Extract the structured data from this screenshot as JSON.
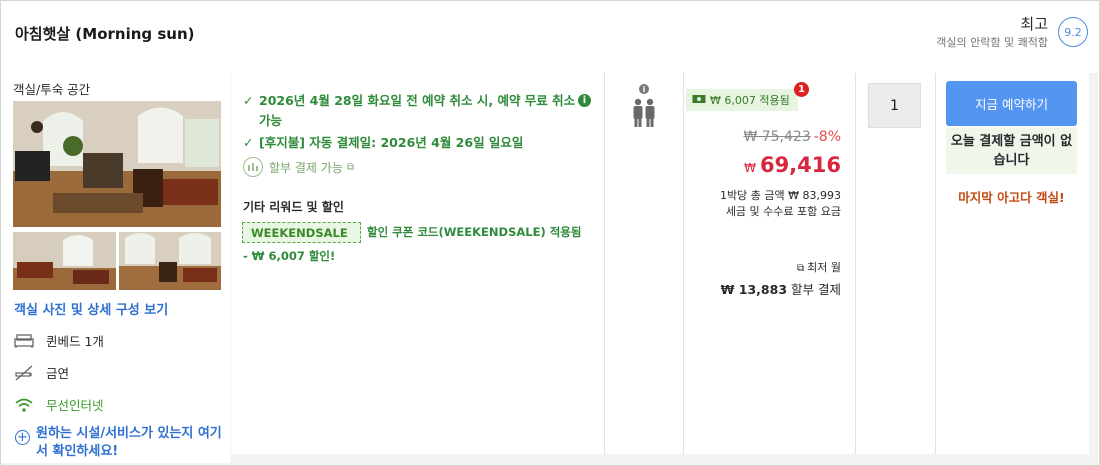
{
  "header": {
    "room_title": "아침햇살 (Morning sun)",
    "rating_word": "최고",
    "rating_sub": "객실의 안락함 및 쾌적함",
    "rating_score": "9.2"
  },
  "left": {
    "space_label": "객실/투숙 공간",
    "photos_link": "객실 사진 및 상세 구성 보기",
    "features": [
      {
        "icon": "bed-icon",
        "label": "퀸베드 1개"
      },
      {
        "icon": "no-smoking-icon",
        "label": "금연"
      },
      {
        "icon": "wifi-icon",
        "label": "무선인터넷"
      }
    ],
    "more_amenities": "원하는 시설/서비스가 있는지 여기서 확인하세요!"
  },
  "info": {
    "cancel_policy": "2026년 4월 28일 화요일 전 예약 취소 시, 예약 무료 취소 가능",
    "pay_later": "[후지불] 자동 결제일: 2026년 4월 26일 일요일",
    "installment": "할부 결제 가능",
    "promo_title": "기타 리워드 및 할인",
    "coupon_code": "WEEKENDSALE",
    "coupon_text": "할인 쿠폰 코드(WEEKENDSALE) 적용됨",
    "coupon_discount": "- ₩ 6,007 할인!"
  },
  "price": {
    "save_tag": "₩ 6,007 적용됨",
    "notification_count": "1",
    "original": "₩ 75,423",
    "discount_pct": "-8%",
    "currency": "₩",
    "final": "69,416",
    "per_night": "1박당 총 금액 ₩ 83,993",
    "taxes": "세금 및 수수료 포함 요금",
    "monthly_label": "최저 월",
    "monthly_amount": "₩ 13,883",
    "monthly_suffix": "할부 결제"
  },
  "quantity": "1",
  "cta": {
    "book_now": "지금 예약하기",
    "pay_today": "오늘 결제할 금액이 없습니다",
    "last_chance": "마지막 아고다 객실!"
  },
  "colors": {
    "accent_blue": "#5495f2",
    "green": "#2e8b3a",
    "price_red": "#d7263d",
    "urgency_orange": "#c24a12"
  }
}
